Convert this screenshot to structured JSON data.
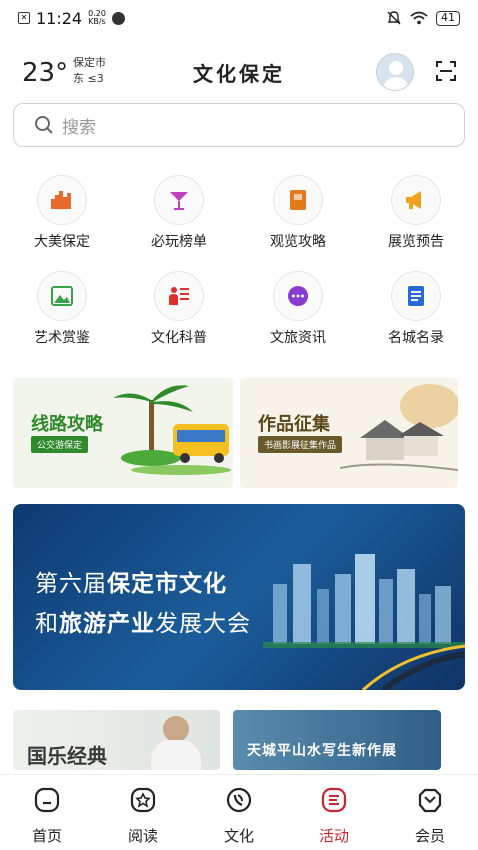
{
  "status_bar": {
    "box_glyph": "✕",
    "time": "11:24",
    "speed_value": "0.20",
    "speed_unit": "KB/s",
    "battery": "41"
  },
  "header": {
    "temperature": "23°",
    "city": "保定市",
    "wind": "东  ≤3",
    "title": "文化保定"
  },
  "search": {
    "placeholder": "搜索"
  },
  "grid": {
    "items": [
      {
        "label": "大美保定",
        "icon": "city-icon",
        "color": "#e86a2a"
      },
      {
        "label": "必玩榜单",
        "icon": "cocktail-icon",
        "color": "#c040c0"
      },
      {
        "label": "观览攻略",
        "icon": "book-icon",
        "color": "#e07a1a"
      },
      {
        "label": "展览预告",
        "icon": "megaphone-icon",
        "color": "#f0a020"
      },
      {
        "label": "艺术赏鉴",
        "icon": "picture-icon",
        "color": "#3aa24a"
      },
      {
        "label": "文化科普",
        "icon": "teacher-icon",
        "color": "#e0302a"
      },
      {
        "label": "文旅资讯",
        "icon": "chat-icon",
        "color": "#8a3ad0"
      },
      {
        "label": "名城名录",
        "icon": "list-icon",
        "color": "#2a6ad8"
      }
    ]
  },
  "promos": {
    "left": {
      "title": "线路攻略",
      "subtitle": "公交游保定",
      "color": "#2e8a2a"
    },
    "right": {
      "title": "作品征集",
      "subtitle": "书画影展征集作品",
      "color": "#5a4a1a"
    }
  },
  "banner": {
    "line1_normal": "第六届",
    "line1_bold": "保定市文化",
    "line2_normal_a": "和",
    "line2_bold": "旅游产业",
    "line2_normal_b": "发展大会"
  },
  "previews": {
    "left": "国乐经典",
    "right": "天城平山水写生新作展"
  },
  "tabbar": {
    "tabs": [
      {
        "label": "首页"
      },
      {
        "label": "阅读"
      },
      {
        "label": "文化"
      },
      {
        "label": "活动"
      },
      {
        "label": "会员"
      }
    ],
    "active_color": "#c8262e"
  }
}
